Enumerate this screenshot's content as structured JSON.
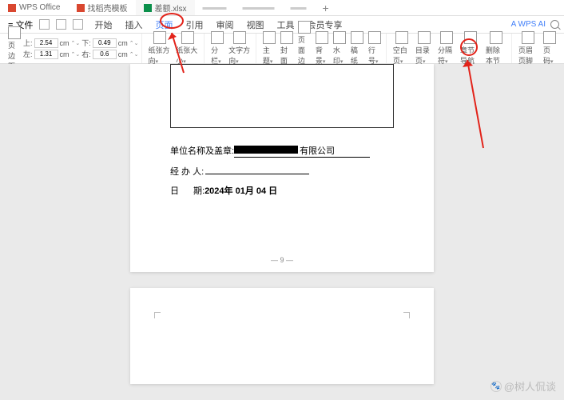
{
  "tabs": [
    {
      "icon": "wps",
      "label": "WPS Office"
    },
    {
      "icon": "doc",
      "label": "找稻壳模板"
    },
    {
      "icon": "xls",
      "label": "差额.xlsx"
    }
  ],
  "menu": {
    "file": "文件",
    "items": [
      "开始",
      "插入",
      "页面",
      "引用",
      "审阅",
      "视图",
      "工具",
      "会员专享"
    ],
    "active_index": 2,
    "wps_ai": "WPS AI"
  },
  "ribbon": {
    "margin": {
      "top_label": "上:",
      "top_val": "2.54",
      "unit": "cm",
      "bottom_label": "下:",
      "bottom_val": "0.49",
      "left_label": "左:",
      "left_val": "1.31",
      "right_label": "右:",
      "right_val": "0.6",
      "btn": "页边距"
    },
    "paper_size": "纸张大小",
    "orientation": "纸张方向",
    "columns": "分栏",
    "text_dir": "文字方向",
    "themes": "主题",
    "cover": "封面",
    "bg": "页面边框",
    "bg2": "背景",
    "watermark": "水印",
    "paper": "稿纸",
    "line_num": "行号",
    "blank": "空白页",
    "toc": "目录页",
    "page_break": "分隔符",
    "chapter_nav": "章节导航",
    "delete_section": "删除本节",
    "header_footer": "页眉页脚",
    "page_num": "页码"
  },
  "doc": {
    "org_label": "单位名称及盖章:",
    "org_suffix": "有限公司",
    "handler_label": "经 办 人:",
    "date_label": "日",
    "date_label2": "期:",
    "date_value": "2024年 01月 04 日",
    "page_number": "— 9 —"
  },
  "watermark_text": "@树人侃谈"
}
